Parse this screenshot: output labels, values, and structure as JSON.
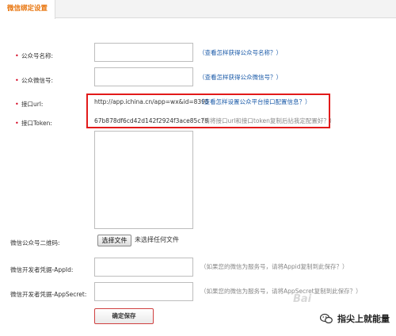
{
  "tab": {
    "title": "微信绑定设置"
  },
  "form": {
    "account_name": {
      "label": "公众号名称:",
      "help": "（查看怎样获得公众号名称？）"
    },
    "wechat_id": {
      "label": "公众微信号:",
      "help": "（查看怎样获得公众微信号？）"
    },
    "api_url": {
      "label": "接口url:",
      "value": "http://app.ichina.cn/app=wx&id=8395",
      "help": "（查看怎样设置公众平台接口配置信息？）"
    },
    "api_token": {
      "label": "接口Token:",
      "value": "67b878df6cd42d142f2924f3ace85c78",
      "help": "（请将接口url和接口token复制后拈我定配置好？）"
    },
    "qrcode": {
      "label": "微信公众号二维码:",
      "file_button": "选择文件",
      "file_status": "未选择任何文件"
    },
    "app_id": {
      "label": "微信开发者凭据-AppId:",
      "help": "（如果您的微信为服务号，请将Appid复制到此保存？）"
    },
    "app_secret": {
      "label": "微信开发者凭据-AppSecret:",
      "help": "（如果您的微信为服务号，请将AppSecret复制到此保存？）"
    },
    "save_button": "确定保存"
  },
  "watermark": {
    "text": "指尖上就能量",
    "baidu": "Bai"
  },
  "colors": {
    "accent_orange": "#e8730a",
    "link_blue": "#1a5aa8",
    "required_red": "#d4001f",
    "highlight_red": "#e21a1a"
  }
}
